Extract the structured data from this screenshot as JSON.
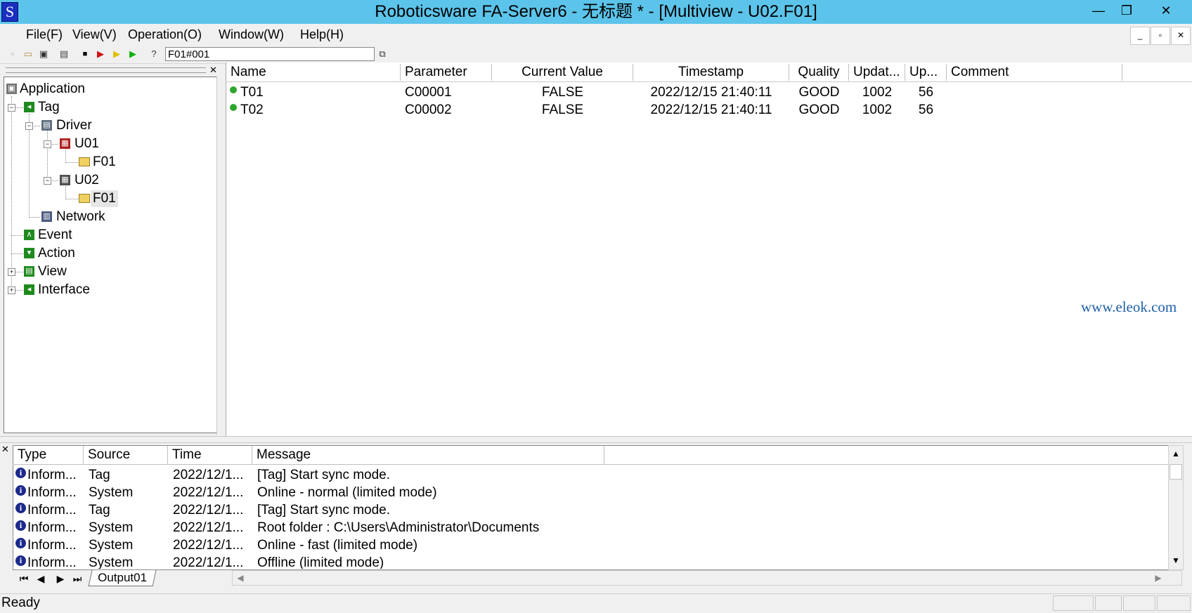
{
  "window": {
    "app_icon_letter": "S",
    "title": "Roboticsware FA-Server6 - 无标题 * - [Multiview - U02.F01]",
    "minimize": "—",
    "maximize": "❐",
    "close": "✕"
  },
  "menu": [
    "File(F)",
    "View(V)",
    "Operation(O)",
    "Window(W)",
    "Help(H)"
  ],
  "mdi_controls": {
    "minimize": "_",
    "restore": "▫",
    "close": "✕"
  },
  "toolbar": {
    "address_value": "F01#001"
  },
  "tree": {
    "items": [
      {
        "label": "Application",
        "icon": "application-icon"
      },
      {
        "label": "Tag",
        "icon": "tag-icon"
      },
      {
        "label": "Driver",
        "icon": "driver-icon"
      },
      {
        "label": "U01",
        "icon": "device-error-icon"
      },
      {
        "label": "F01",
        "icon": "folder-icon"
      },
      {
        "label": "U02",
        "icon": "device-icon"
      },
      {
        "label": "F01",
        "icon": "folder-open-icon"
      },
      {
        "label": "Network",
        "icon": "network-icon"
      },
      {
        "label": "Event",
        "icon": "event-icon"
      },
      {
        "label": "Action",
        "icon": "action-icon"
      },
      {
        "label": "View",
        "icon": "view-icon"
      },
      {
        "label": "Interface",
        "icon": "interface-icon"
      }
    ]
  },
  "list": {
    "columns": [
      "Name",
      "Parameter",
      "Current Value",
      "Timestamp",
      "Quality",
      "Updat...",
      "Up...",
      "Comment"
    ],
    "rows": [
      {
        "name": "T01",
        "parameter": "C00001",
        "value": "FALSE",
        "timestamp": "2022/12/15 21:40:11",
        "quality": "GOOD",
        "update": "1002",
        "up": "56",
        "comment": ""
      },
      {
        "name": "T02",
        "parameter": "C00002",
        "value": "FALSE",
        "timestamp": "2022/12/15 21:40:11",
        "quality": "GOOD",
        "update": "1002",
        "up": "56",
        "comment": ""
      }
    ]
  },
  "output": {
    "columns": [
      "Type",
      "Source",
      "Time",
      "Message"
    ],
    "rows": [
      {
        "type": "Inform...",
        "source": "Tag",
        "time": "2022/12/1...",
        "message": "[Tag] Start sync mode."
      },
      {
        "type": "Inform...",
        "source": "System",
        "time": "2022/12/1...",
        "message": "Online - normal (limited mode)"
      },
      {
        "type": "Inform...",
        "source": "Tag",
        "time": "2022/12/1...",
        "message": "[Tag] Start sync mode."
      },
      {
        "type": "Inform...",
        "source": "System",
        "time": "2022/12/1...",
        "message": "Root folder : C:\\Users\\Administrator\\Documents"
      },
      {
        "type": "Inform...",
        "source": "System",
        "time": "2022/12/1...",
        "message": "Online - fast (limited mode)"
      },
      {
        "type": "Inform...",
        "source": "System",
        "time": "2022/12/1...",
        "message": "Offline (limited mode)"
      }
    ],
    "tab_label": "Output01"
  },
  "status": {
    "text": "Ready"
  },
  "watermark": "www.eleok.com",
  "colors": {
    "titlebar": "#5cc4ea",
    "status_good": "#2da52d",
    "tree_icon_green": "#1e8a1e"
  }
}
